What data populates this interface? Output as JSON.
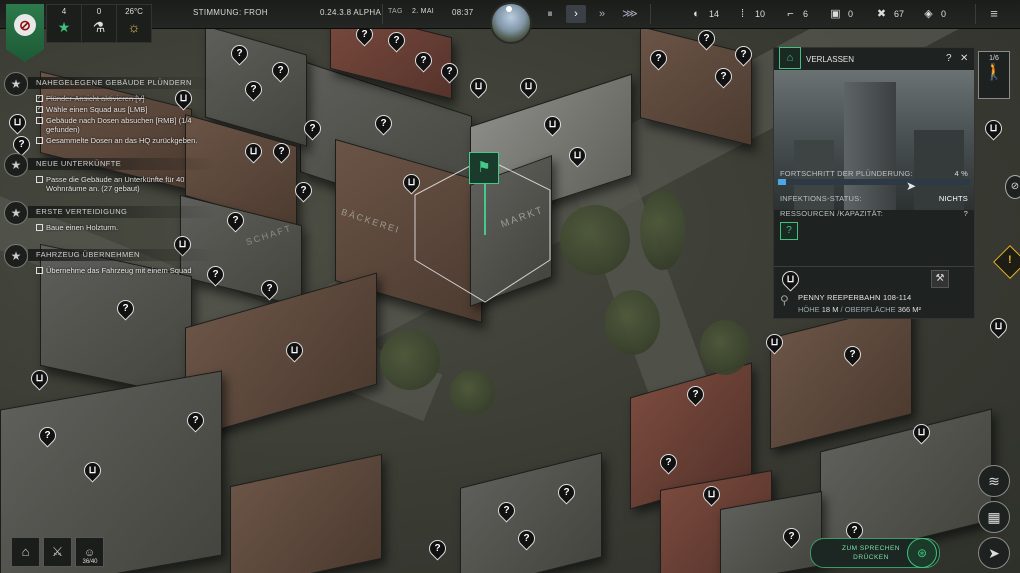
{
  "topbar": {
    "stat_people": "4",
    "stat_science": "0",
    "temperature": "26°C",
    "mood": "STIMMUNG: FROH",
    "version": "0.24.3.8 ALPHA",
    "day_label": "TAG",
    "date": "2. MAI",
    "time": "08:37",
    "resources": [
      {
        "icon": "food-icon",
        "glyph": "◐",
        "value": "14"
      },
      {
        "icon": "ammo-icon",
        "glyph": "⁞",
        "value": "10"
      },
      {
        "icon": "weapon-icon",
        "glyph": "⌐",
        "value": "6"
      },
      {
        "icon": "parts-icon",
        "glyph": "▣",
        "value": "0"
      },
      {
        "icon": "tools-icon",
        "glyph": "✖",
        "value": "67"
      },
      {
        "icon": "material-icon",
        "glyph": "◈",
        "value": "0"
      }
    ],
    "menu_glyph": "≡",
    "speed_controls": [
      "⏸",
      "›",
      "»",
      "⋙"
    ]
  },
  "tasks": [
    {
      "title": "NAHEGELEGENE GEBÄUDE PLÜNDERN",
      "items": [
        {
          "text": "Plünder-Ansicht aktivieren [V]",
          "done": true
        },
        {
          "text": "Wähle einen Squad aus [LMB]",
          "done": true
        },
        {
          "text": "Gebäude nach Dosen absuchen [RMB] (1/4 gefunden)",
          "done": false
        },
        {
          "text": "Gesammelte Dosen an das HQ zurückgeben.",
          "done": false
        }
      ]
    },
    {
      "title": "NEUE UNTERKÜNFTE",
      "items": [
        {
          "text": "Passe die Gebäude an Unterkünfte für 40 Wohnräume an. (27 gebaut)",
          "done": false
        }
      ]
    },
    {
      "title": "ERSTE VERTEIDIGUNG",
      "items": [
        {
          "text": "Baue einen Holzturm.",
          "done": false
        }
      ]
    },
    {
      "title": "FAHRZEUG ÜBERNEHMEN",
      "items": [
        {
          "text": "Übernehme das Fahrzeug mit einem Squad",
          "done": false
        }
      ]
    }
  ],
  "panel": {
    "title": "VERLASSEN",
    "help": "?",
    "close": "✕",
    "progress_label": "FORTSCHRITT DER PLÜNDERUNG:",
    "progress_value": "4 %",
    "progress_fraction": 0.04,
    "infection_label": "INFEKTIONS-STATUS:",
    "infection_value": "NICHTS",
    "resources_label": "RESSOURCEN /KAPAZITÄT:",
    "resources_help": "?",
    "unknown_glyph": "?",
    "address": "PENNY REEPERBAHN 108-114",
    "height_label": "HÖHE",
    "height_value": "18 M",
    "surface_label": "OBERFLÄCHE",
    "surface_value": "366 M²"
  },
  "squad_counter": "1/6",
  "speak_button": {
    "line1": "ZUM SPRECHEN",
    "line2": "DRÜCKEN"
  },
  "population": "36/40",
  "map_signs": [
    "MARKT",
    "BÄCKEREI",
    "SCHAFT"
  ]
}
